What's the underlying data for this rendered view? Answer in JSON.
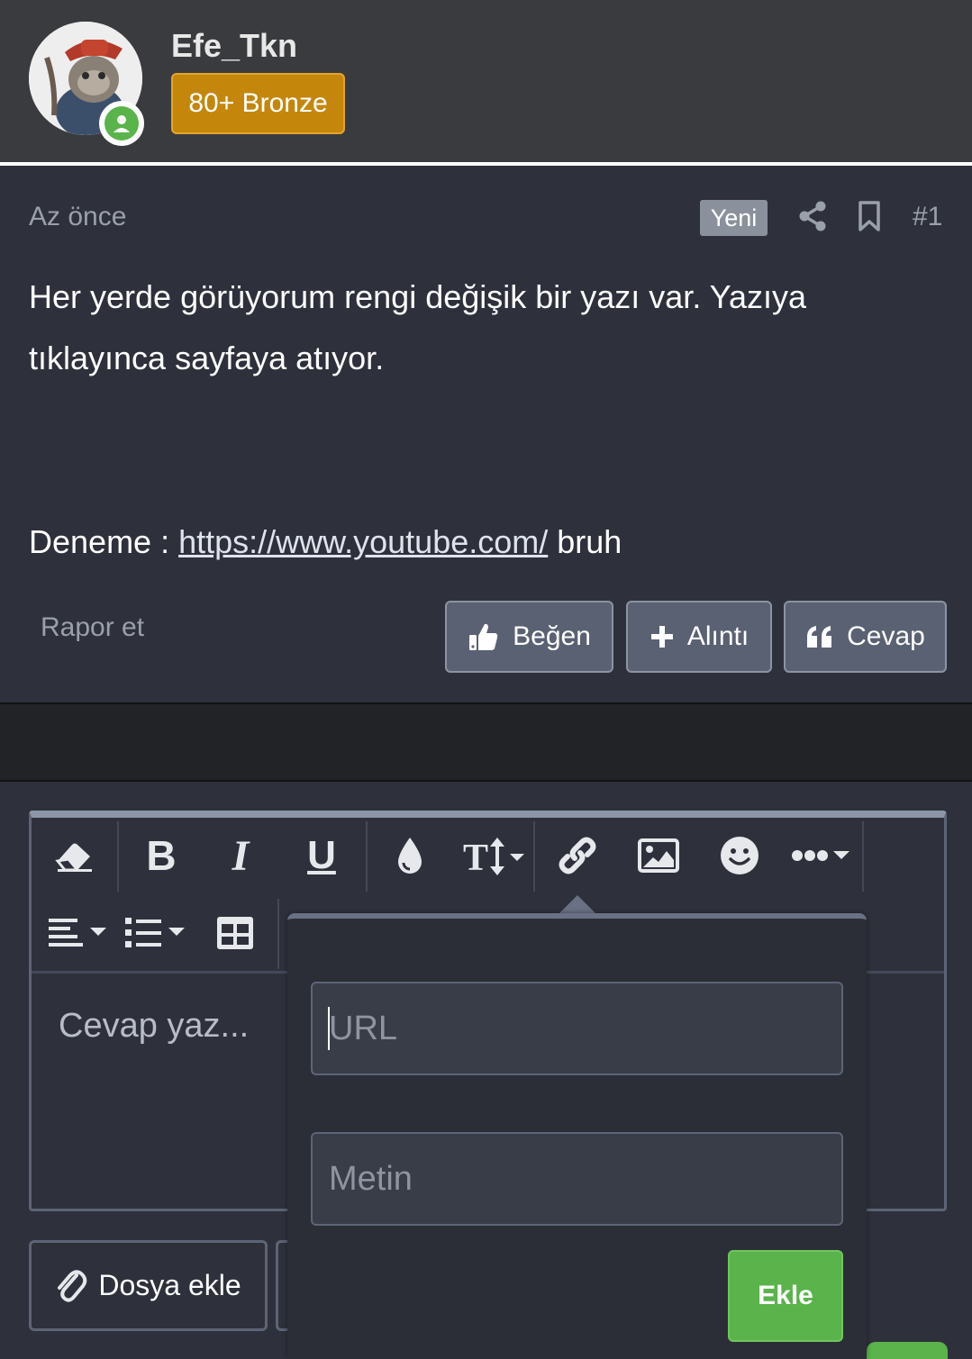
{
  "user": {
    "name": "Efe_Tkn",
    "rank": "80+ Bronze"
  },
  "post": {
    "time": "Az önce",
    "new_badge": "Yeni",
    "number": "#1",
    "line1": "Her yerde görüyorum rengi değişik bir yazı var. Yazıya tıklayınca sayfaya atıyor.",
    "deneme_prefix": "Deneme : ",
    "deneme_link": "https://www.youtube.com/",
    "deneme_suffix": " bruh",
    "report": "Rapor et",
    "actions": {
      "like": "Beğen",
      "quote": "Alıntı",
      "reply": "Cevap"
    }
  },
  "editor": {
    "placeholder": "Cevap yaz...",
    "attach": "Dosya ekle"
  },
  "link_popup": {
    "url_placeholder": "URL",
    "text_placeholder": "Metin",
    "submit": "Ekle"
  },
  "colors": {
    "background": "#2e313b",
    "header": "#3a3b3e",
    "rank_badge": "#c4870c",
    "online": "#5ab34b",
    "button": "#5a6172",
    "submit": "#5ab34b"
  }
}
